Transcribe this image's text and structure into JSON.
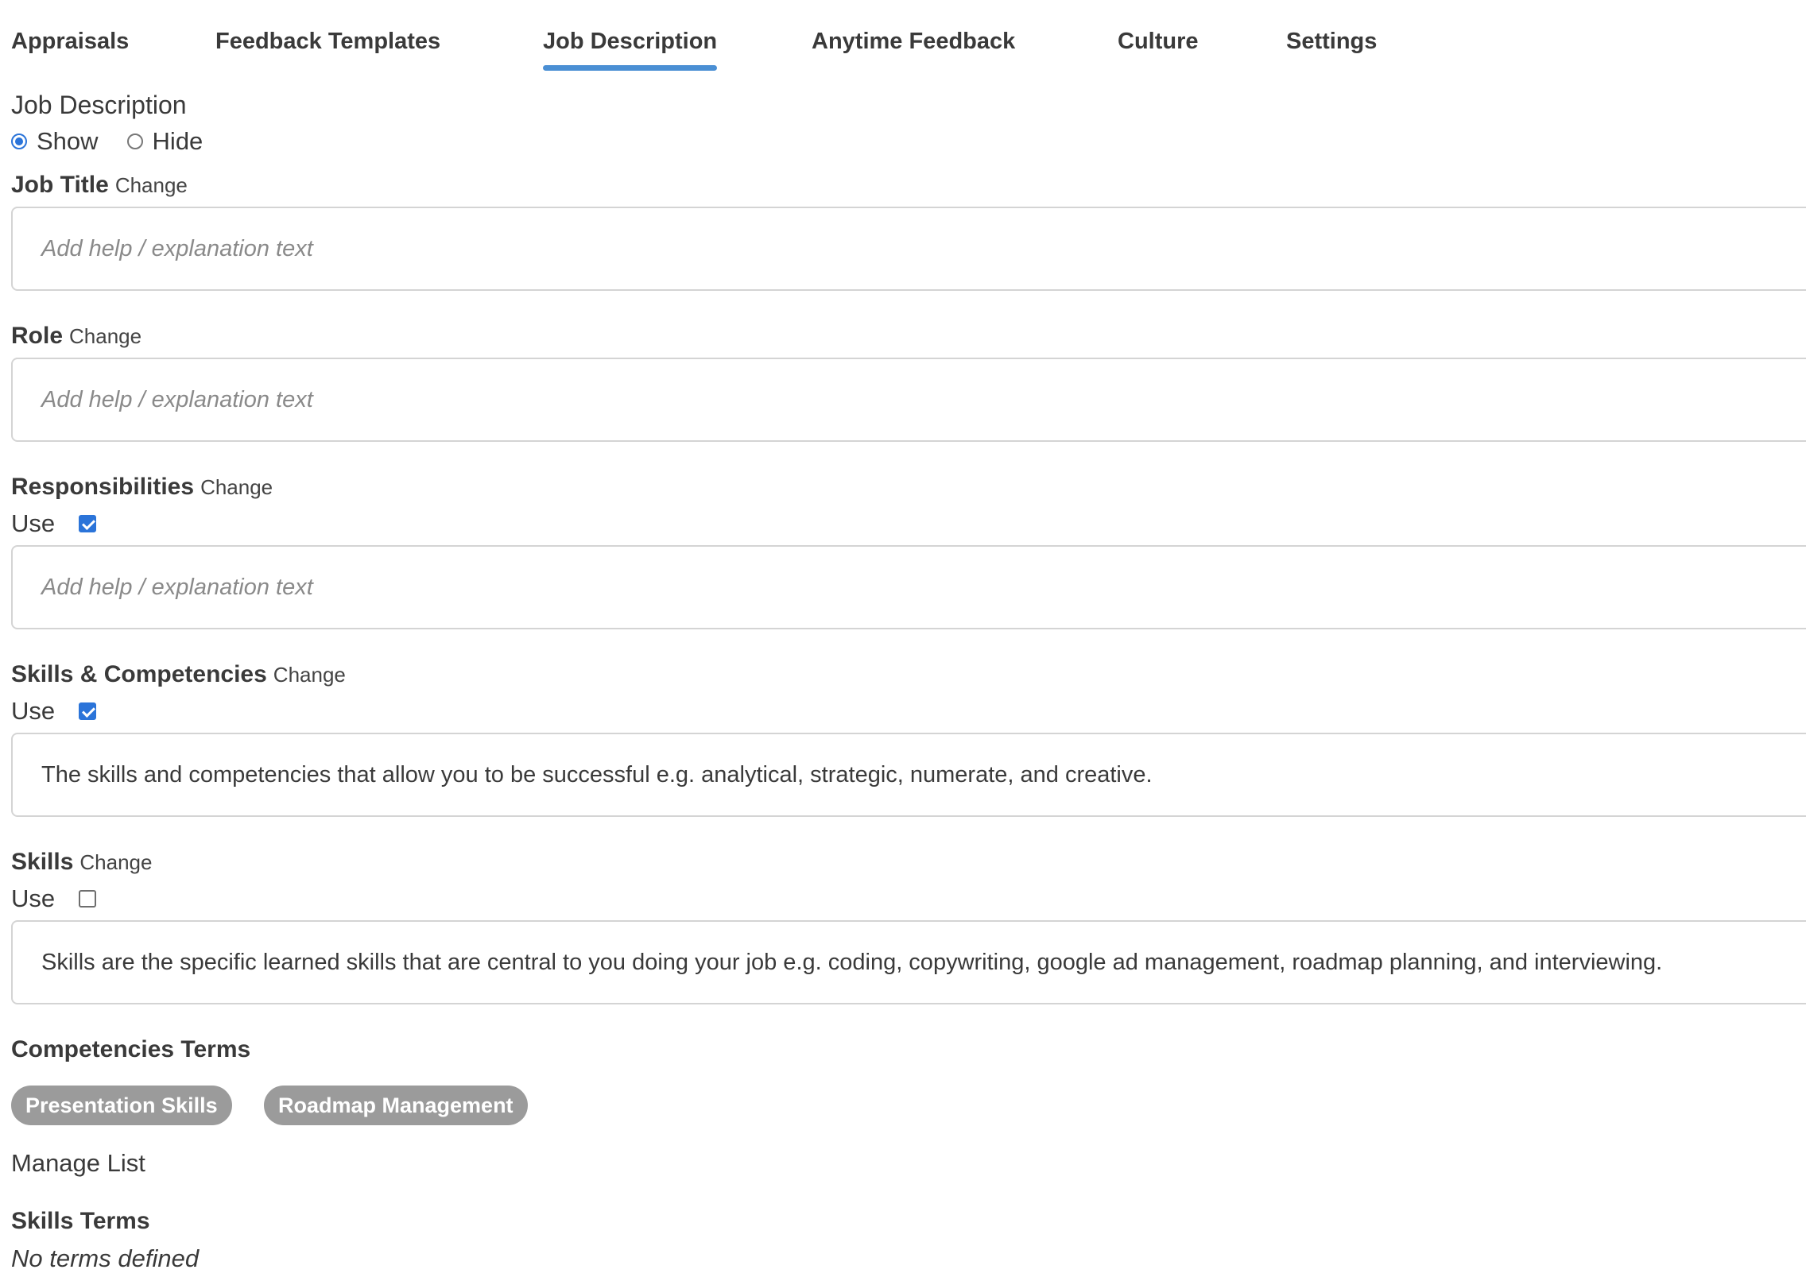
{
  "tabs": [
    {
      "label": "Appraisals",
      "active": false
    },
    {
      "label": "Feedback Templates",
      "active": false
    },
    {
      "label": "Job Description",
      "active": true
    },
    {
      "label": "Anytime Feedback",
      "active": false
    },
    {
      "label": "Culture",
      "active": false
    },
    {
      "label": "Settings",
      "active": false
    }
  ],
  "job_description": {
    "title": "Job Description",
    "visibility_options": [
      "Show",
      "Hide"
    ],
    "visibility_selected": "Show"
  },
  "fields": {
    "job_title": {
      "label": "Job Title",
      "change": "Change",
      "placeholder": "Add help / explanation text",
      "value": ""
    },
    "role": {
      "label": "Role",
      "change": "Change",
      "placeholder": "Add help / explanation text",
      "value": ""
    },
    "responsibilities": {
      "label": "Responsibilities",
      "change": "Change",
      "use_label": "Use",
      "use_checked": true,
      "placeholder": "Add help / explanation text",
      "value": ""
    },
    "skills_competencies": {
      "label": "Skills & Competencies",
      "change": "Change",
      "use_label": "Use",
      "use_checked": true,
      "value": "The skills and competencies that allow you to be successful e.g. analytical, strategic, numerate, and creative."
    },
    "skills": {
      "label": "Skills",
      "change": "Change",
      "use_label": "Use",
      "use_checked": false,
      "value": "Skills are the specific learned skills that are central to you doing your job e.g. coding, copywriting, google ad management, roadmap planning, and interviewing."
    }
  },
  "competencies_terms": {
    "title": "Competencies Terms",
    "terms": [
      "Presentation Skills",
      "Roadmap Management"
    ],
    "manage_label": "Manage List"
  },
  "skills_terms": {
    "title": "Skills Terms",
    "empty_text": "No terms defined"
  },
  "colors": {
    "accent": "#2b74d9",
    "tab_underline": "#4a8fd4",
    "pill_bg": "#9b9b9b"
  }
}
